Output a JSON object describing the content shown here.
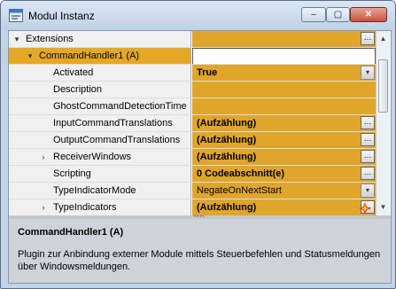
{
  "window": {
    "title": "Modul Instanz",
    "min_label": "‒",
    "max_label": "▢",
    "close_label": "✕"
  },
  "grid": {
    "rows": [
      {
        "label": "Extensions",
        "expander": "▾",
        "value": "",
        "value_button": "…"
      },
      {
        "label": "CommandHandler1 (A)",
        "expander": "▾",
        "value": ""
      },
      {
        "label": "Activated",
        "value": "True",
        "value_button": "▾"
      },
      {
        "label": "Description",
        "value": ""
      },
      {
        "label": "GhostCommandDetectionTime",
        "value": ""
      },
      {
        "label": "InputCommandTranslations",
        "value": "(Aufzählung)",
        "value_button": "…"
      },
      {
        "label": "OutputCommandTranslations",
        "value": "(Aufzählung)",
        "value_button": "…"
      },
      {
        "label": "ReceiverWindows",
        "expander": "›",
        "value": "(Aufzählung)",
        "value_button": "…"
      },
      {
        "label": "Scripting",
        "value": "0 Codeabschnitt(e)",
        "value_button": "…"
      },
      {
        "label": "TypeIndicatorMode",
        "value": "NegateOnNextStart",
        "value_button": "▾"
      },
      {
        "label": "TypeIndicators",
        "expander": "›",
        "value": "(Aufzählung)",
        "value_button": "…"
      }
    ]
  },
  "help": {
    "title": "CommandHandler1 (A)",
    "description": "Plugin zur Anbindung externer Module mittels Steuerbefehlen und Statusmeldungen über Windowsmeldungen."
  },
  "colors": {
    "value_cell": "#e0a62b",
    "selected_row": "#e5a826"
  }
}
